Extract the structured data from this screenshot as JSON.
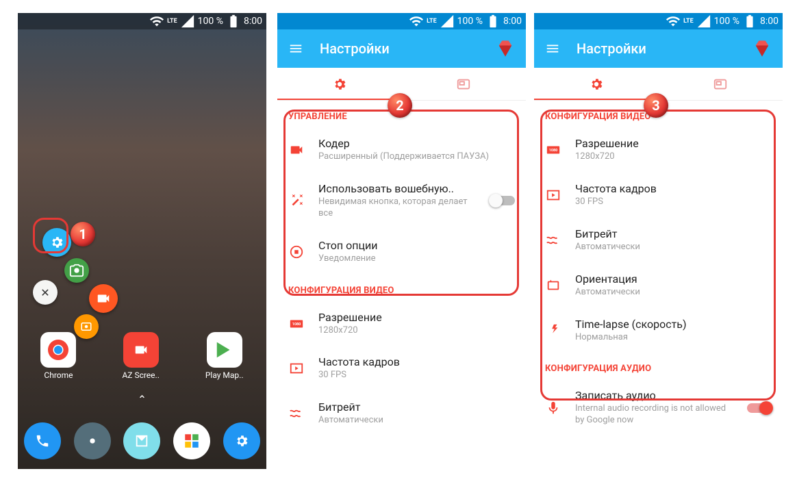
{
  "status": {
    "network": "LTE",
    "battery": "100 %",
    "time": "8:00"
  },
  "app": {
    "title": "Настройки"
  },
  "step2": {
    "section1": "УПРАВЛЕНИЕ",
    "coder_label": "Кодер",
    "coder_sub": "Расширенный (Поддерживается ПАУЗА)",
    "magic_label": "Использовать вошебную..",
    "magic_sub": "Невидимая кнопка, которая делает все",
    "stop_label": "Стоп опции",
    "stop_sub": "Уведомление",
    "section2": "КОНФИГУРАЦИЯ ВИДЕО",
    "resolution_label": "Разрешение",
    "resolution_sub": "1280x720",
    "fps_label": "Частота кадров",
    "fps_sub": "30 FPS",
    "bitrate_label": "Битрейт",
    "bitrate_sub": "Автоматически"
  },
  "step3": {
    "section1": "КОНФИГУРАЦИЯ ВИДЕО",
    "resolution_label": "Разрешение",
    "resolution_sub": "1280x720",
    "fps_label": "Частота кадров",
    "fps_sub": "30 FPS",
    "bitrate_label": "Битрейт",
    "bitrate_sub": "Автоматически",
    "orientation_label": "Ориентация",
    "orientation_sub": "Автоматически",
    "timelapse_label": "Time-lapse (скорость)",
    "timelapse_sub": "Нормальная",
    "section2": "КОНФИГУРАЦИЯ АУДИО",
    "audio_label": "Записать аудио",
    "audio_sub": "Internal audio recording is not allowed by Google now"
  },
  "home": {
    "apps": [
      "Chrome",
      "AZ Scree..",
      "Play Мар.."
    ]
  },
  "badges": {
    "s1": "1",
    "s2": "2",
    "s3": "3"
  }
}
